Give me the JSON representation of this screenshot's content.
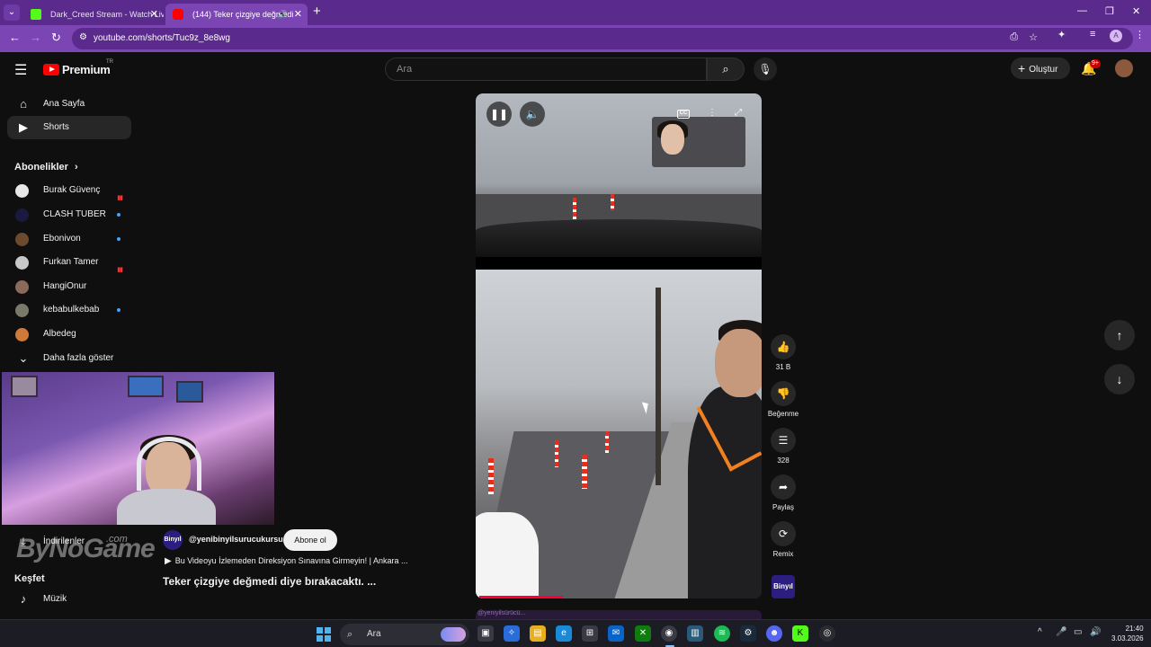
{
  "browser": {
    "tabs": [
      {
        "title": "Dark_Creed Stream - Watch Liv",
        "active": false
      },
      {
        "title": "(144) Teker çizgiye değmedi",
        "active": true
      }
    ],
    "url": "youtube.com/shorts/Tuc9z_8e8wg",
    "profile_letter": "A",
    "accent_color": "#7b46b3"
  },
  "header": {
    "logo_text": "Premium",
    "logo_country": "TR",
    "search_placeholder": "Ara",
    "create_label": "Oluştur",
    "notification_badge": "9+"
  },
  "sidebar": {
    "nav": [
      {
        "label": "Ana Sayfa",
        "icon": "home-icon",
        "active": false
      },
      {
        "label": "Shorts",
        "icon": "shorts-icon",
        "active": true
      }
    ],
    "subscriptions_heading": "Abonelikler",
    "subscriptions": [
      {
        "name": "Burak Güvenç",
        "indicator": "live",
        "avatar_color": "#e8e8e8"
      },
      {
        "name": "CLASH TUBER",
        "indicator": "dot",
        "avatar_color": "#1a1a40"
      },
      {
        "name": "Ebonivon",
        "indicator": "dot",
        "avatar_color": "#6b4a2e"
      },
      {
        "name": "Furkan Tamer",
        "indicator": "live",
        "avatar_color": "#c8c8c8"
      },
      {
        "name": "HangiOnur",
        "indicator": "none",
        "avatar_color": "#8a6a5a"
      },
      {
        "name": "kebabulkebab",
        "indicator": "dot",
        "avatar_color": "#7a7a6a"
      },
      {
        "name": "Albedeg",
        "indicator": "none",
        "avatar_color": "#d07a3a"
      }
    ],
    "show_more_label": "Daha fazla göster",
    "partial_item_label": "İndirilenler",
    "explore_heading": "Keşfet",
    "explore_items": [
      {
        "label": "Müzik",
        "icon": "music-note-icon"
      }
    ]
  },
  "watermark": {
    "text": "ByNoGame",
    "suffix": ".com"
  },
  "short": {
    "channel_handle": "@yenibinyilsurucukursu",
    "channel_avatar_text": "Binyıl",
    "subscribe_label": "Abone ol",
    "related_video": "Bu Videoyu İzlemeden Direksiyon Sınavına Girmeyin! | Ankara ...",
    "title": "Teker çizgiye değmedi diye bırakacaktı. ...",
    "progress": 0.3,
    "actions": [
      {
        "id": "like",
        "icon": "thumbs-up-icon",
        "label": "31 B"
      },
      {
        "id": "dislike",
        "icon": "thumbs-down-icon",
        "label": "Beğenme"
      },
      {
        "id": "comments",
        "icon": "comment-icon",
        "label": "328"
      },
      {
        "id": "share",
        "icon": "share-icon",
        "label": "Paylaş"
      },
      {
        "id": "remix",
        "icon": "remix-icon",
        "label": "Remix"
      }
    ],
    "next_label": "@yeniyilsürücü..."
  },
  "taskbar": {
    "search_placeholder": "Ara",
    "time": "21:40",
    "date": "3.03.2026"
  }
}
